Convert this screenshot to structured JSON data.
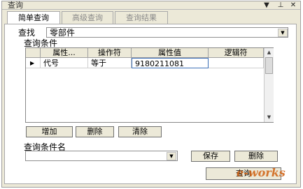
{
  "window": {
    "title": "查询"
  },
  "tabs": [
    "简单查询",
    "高级查询",
    "查询结果"
  ],
  "search": {
    "label": "查找",
    "value": "零部件"
  },
  "conditions": {
    "group_label": "查询条件",
    "columns": [
      "属性...",
      "操作符",
      "属性值",
      "逻辑符"
    ],
    "row_marker": "▶",
    "rows": [
      {
        "attribute": "代号",
        "operator": "等于",
        "value": "9180211081",
        "logic": ""
      }
    ]
  },
  "buttons": {
    "add": "增加",
    "delete": "删除",
    "clear": "清除"
  },
  "condition_name": {
    "label": "查询条件名",
    "value": "",
    "save": "保存",
    "delete": "删除"
  },
  "footer": {
    "query": "查询"
  },
  "watermark": "e-works"
}
